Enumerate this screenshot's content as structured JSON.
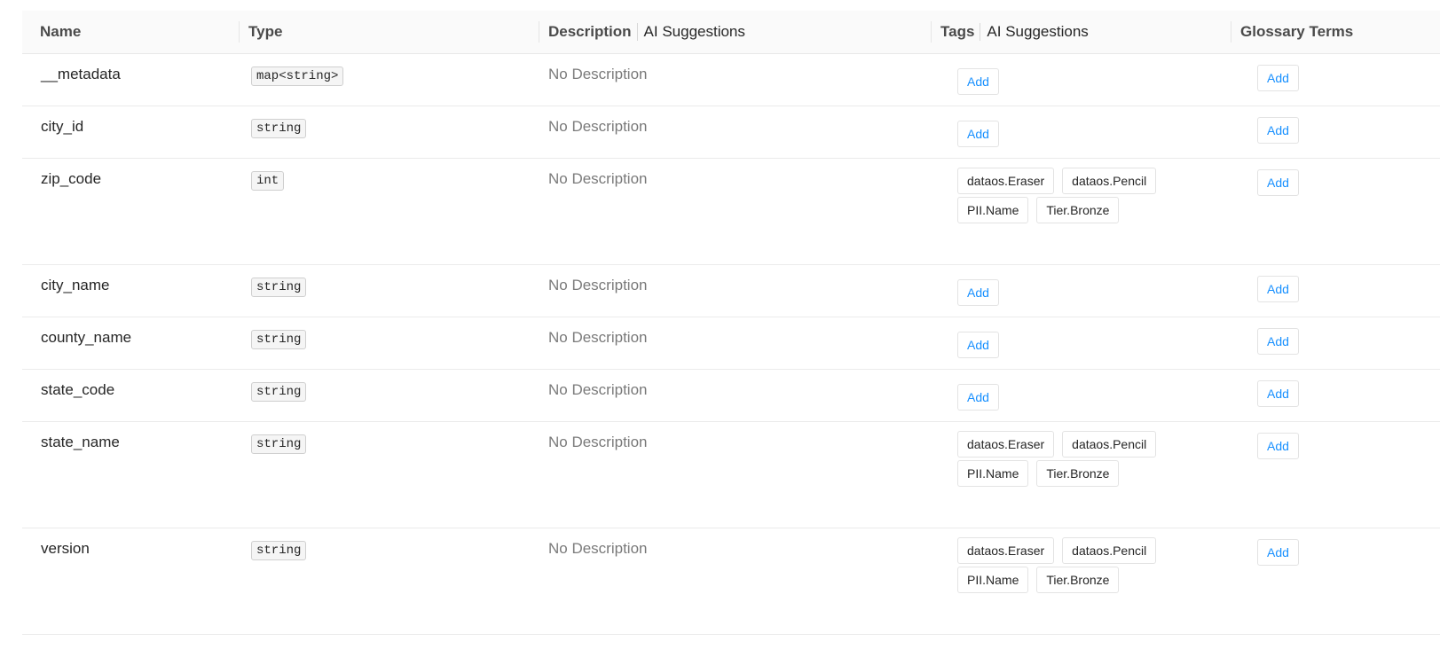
{
  "columns": {
    "name": "Name",
    "type": "Type",
    "description": "Description",
    "description_ai": "AI Suggestions",
    "tags": "Tags",
    "tags_ai": "AI Suggestions",
    "glossary": "Glossary Terms"
  },
  "add_label": "Add",
  "rows": [
    {
      "name": "__metadata",
      "type": "map<string>",
      "description": "No Description",
      "tags": []
    },
    {
      "name": "city_id",
      "type": "string",
      "description": "No Description",
      "tags": []
    },
    {
      "name": "zip_code",
      "type": "int",
      "description": "No Description",
      "tags": [
        "dataos.Eraser",
        "dataos.Pencil",
        "PII.Name",
        "Tier.Bronze"
      ]
    },
    {
      "name": "city_name",
      "type": "string",
      "description": "No Description",
      "tags": []
    },
    {
      "name": "county_name",
      "type": "string",
      "description": "No Description",
      "tags": []
    },
    {
      "name": "state_code",
      "type": "string",
      "description": "No Description",
      "tags": []
    },
    {
      "name": "state_name",
      "type": "string",
      "description": "No Description",
      "tags": [
        "dataos.Eraser",
        "dataos.Pencil",
        "PII.Name",
        "Tier.Bronze"
      ]
    },
    {
      "name": "version",
      "type": "string",
      "description": "No Description",
      "tags": [
        "dataos.Eraser",
        "dataos.Pencil",
        "PII.Name",
        "Tier.Bronze"
      ]
    }
  ]
}
